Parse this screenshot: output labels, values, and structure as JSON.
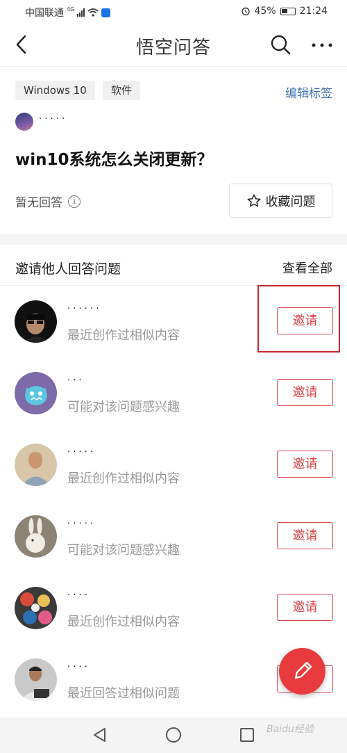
{
  "status_bar": {
    "carrier": "中国联通",
    "network": "4G",
    "battery": "45%",
    "time": "21:24"
  },
  "nav": {
    "title": "悟空问答"
  },
  "question": {
    "tags": [
      "Windows 10",
      "软件"
    ],
    "edit_tags_label": "编辑标签",
    "author_name": "·  ·  · ·  ·",
    "title": "win10系统怎么关闭更新？",
    "answers_status": "暂无回答",
    "collect_label": "收藏问题"
  },
  "invite": {
    "title": "邀请他人回答问题",
    "view_all_label": "查看全部",
    "invite_label": "邀请",
    "users": [
      {
        "name": "·  ·  ·  ·  ·  ·",
        "reason": "最近创作过相似内容"
      },
      {
        "name": "·  ·  ·",
        "reason": "可能对该问题感兴趣"
      },
      {
        "name": "·  ·  ·  ·  ·",
        "reason": "最近创作过相似内容"
      },
      {
        "name": "·  ·  ·  ·  ·",
        "reason": "可能对该问题感兴趣"
      },
      {
        "name": "·  ·  ·  ·",
        "reason": "最近创作过相似内容"
      },
      {
        "name": "·  ·  ·  ·",
        "reason": "最近回答过相似问题"
      }
    ]
  },
  "watermark": "Baidu经验",
  "colors": {
    "accent_red": "#d9464b",
    "link_blue": "#3d72b0",
    "fab_red": "#e93b3d"
  }
}
